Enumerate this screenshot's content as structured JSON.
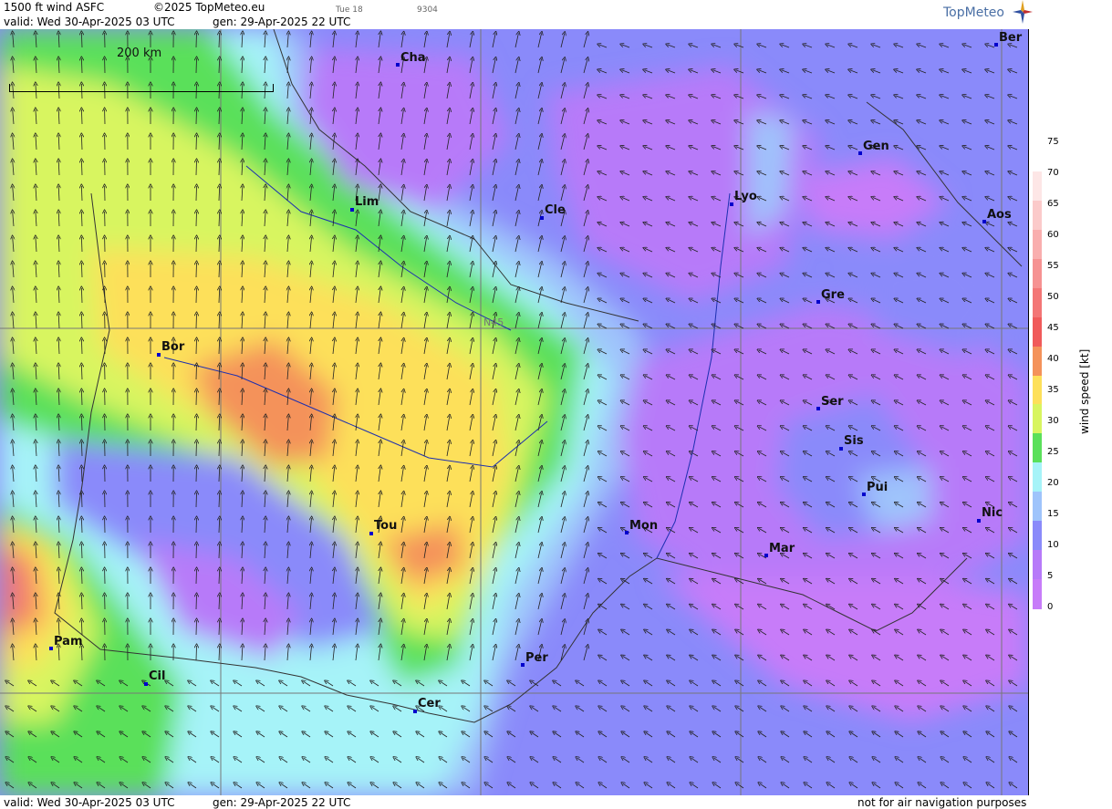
{
  "header": {
    "product": "1500 ft wind ASFC",
    "copyright": "©2025 TopMeteo.eu",
    "tue": "Tue 18",
    "code": "9304",
    "valid": "valid:  Wed  30-Apr-2025  03 UTC",
    "gen": "gen: 29-Apr-2025 22 UTC",
    "logo": "TopMeteo"
  },
  "map": {
    "scale_label": "200 km",
    "lat_label": "N45",
    "cities": [
      {
        "name": "Ber"
      },
      {
        "name": "Cha"
      },
      {
        "name": "Gen"
      },
      {
        "name": "Lim"
      },
      {
        "name": "Cle"
      },
      {
        "name": "Lyo"
      },
      {
        "name": "Aos"
      },
      {
        "name": "Gre"
      },
      {
        "name": "Bor"
      },
      {
        "name": "Ser"
      },
      {
        "name": "Sis"
      },
      {
        "name": "Pui"
      },
      {
        "name": "Tou"
      },
      {
        "name": "Mon"
      },
      {
        "name": "Nic"
      },
      {
        "name": "Mar"
      },
      {
        "name": "Pam"
      },
      {
        "name": "Per"
      },
      {
        "name": "Cil"
      },
      {
        "name": "Cer"
      }
    ]
  },
  "legend": {
    "title": "wind  speed  [kt]",
    "ticks": [
      "75",
      "70",
      "65",
      "60",
      "55",
      "50",
      "45",
      "40",
      "35",
      "30",
      "25",
      "20",
      "15",
      "10",
      "5",
      "0"
    ],
    "colors": [
      "#ffffff",
      "#fde6e6",
      "#fbcaca",
      "#f9aeae",
      "#f69292",
      "#f37676",
      "#f05a5a",
      "#f4925a",
      "#fde05a",
      "#d8f560",
      "#5ae05a",
      "#a6f3f8",
      "#9fc4fb",
      "#8a8afa",
      "#b77af9",
      "#c77cf9"
    ]
  },
  "footer": {
    "valid": "valid:  Wed  30-Apr-2025  03 UTC",
    "gen": "gen: 29-Apr-2025 22 UTC",
    "note": "not for air navigation purposes"
  }
}
